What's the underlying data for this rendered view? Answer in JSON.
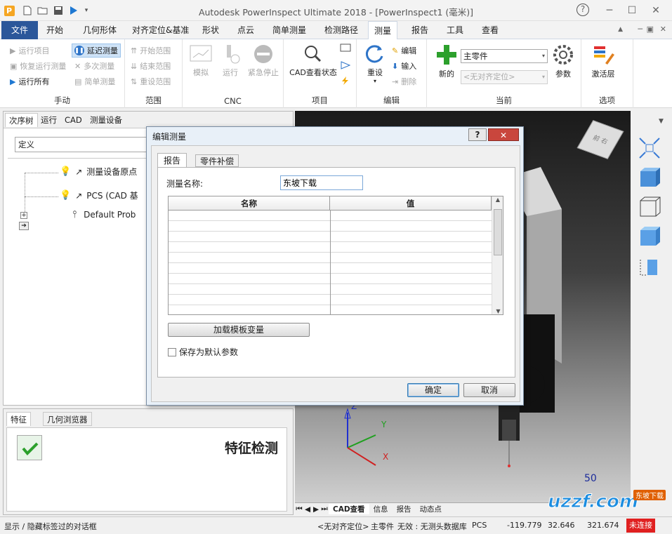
{
  "window": {
    "title": "Autodesk PowerInspect Ultimate 2018 - [PowerInspect1 (毫米)]",
    "help": "?",
    "minimize": "─",
    "restore": "☐",
    "close": "✕"
  },
  "tabs": [
    "文件",
    "开始",
    "几何形体",
    "对齐定位&基准",
    "形状",
    "点云",
    "简单测量",
    "检测路径",
    "测量",
    "报告",
    "工具",
    "查看"
  ],
  "ribbon": {
    "manual": {
      "label": "手动",
      "items": [
        "运行项目",
        "恢复运行测量",
        "运行所有",
        "延迟测量",
        "多次测量",
        "简单测量"
      ]
    },
    "range": {
      "label": "范围",
      "items": [
        "开始范围",
        "结束范围",
        "重设范围"
      ]
    },
    "cnc": {
      "label": "CNC",
      "items": [
        "模拟",
        "运行",
        "紧急停止"
      ]
    },
    "project": {
      "label": "项目",
      "items": [
        "CAD查看状态"
      ]
    },
    "edit": {
      "label": "编辑",
      "items": [
        "重设",
        "编辑",
        "输入",
        "删除"
      ]
    },
    "current": {
      "label": "当前",
      "new": "新的",
      "part": "主零件",
      "align": "<无对齐定位>",
      "params": "参数"
    },
    "options": {
      "label": "选项",
      "activate": "激活层"
    }
  },
  "leftpanel": {
    "tabs": [
      "次序树",
      "运行",
      "CAD",
      "测量设备"
    ],
    "filter": "定义",
    "tree": [
      "测量设备原点",
      "PCS (CAD 基",
      "Default Prob"
    ]
  },
  "bottompanel": {
    "tabs": [
      "特征",
      "几何浏览器"
    ],
    "title": "特征检测"
  },
  "dialog": {
    "title": "编辑测量",
    "help": "?",
    "close": "✕",
    "tabs": [
      "报告",
      "零件补偿"
    ],
    "name_label": "测量名称:",
    "name_value": "东坡下载",
    "col_name": "名称",
    "col_value": "值",
    "load_button": "加载模板变量",
    "checkbox_label": "保存为默认参数",
    "ok": "确定",
    "cancel": "取消"
  },
  "view": {
    "cube_label": "前 右",
    "number": "50",
    "axes": [
      "Z",
      "Y",
      "X"
    ],
    "view_tabs": [
      "CAD查看",
      "信息",
      "报告",
      "动态点"
    ]
  },
  "statusbar": {
    "left": "显示 / 隐藏标签过的对话框",
    "align": "<无对齐定位>",
    "part": "主零件",
    "probe": "无效 : 无测头数据库",
    "pcs": "PCS",
    "x": "-119.779",
    "y": "32.646",
    "z": "321.674",
    "conn": "未连接"
  },
  "watermark": {
    "text": "uzzf.com",
    "badge": "东坡下载"
  },
  "colors": {
    "accent": "#2b579a",
    "active_blue": "#3a7bd5",
    "danger": "#e02020"
  }
}
